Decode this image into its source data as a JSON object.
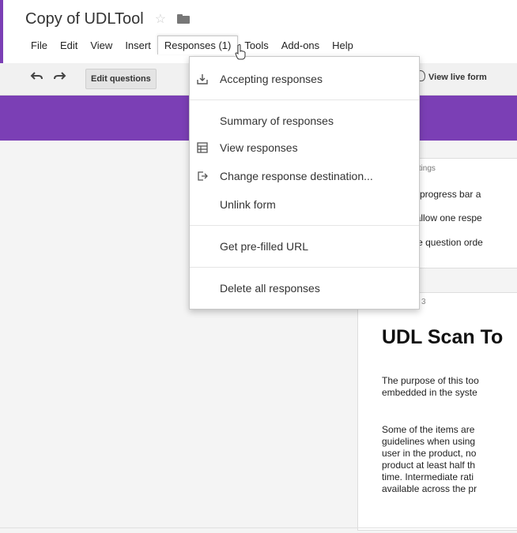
{
  "app": {
    "title": "Copy of UDLTool",
    "accent_color": "#7b3fb5",
    "star_icon": "star-icon",
    "folder_icon": "folder-icon"
  },
  "menu": {
    "file": "File",
    "edit": "Edit",
    "view": "View",
    "insert": "Insert",
    "responses": "Responses (1)",
    "tools": "Tools",
    "addons": "Add-ons",
    "help": "Help"
  },
  "toolbar": {
    "undo_icon": "undo-icon",
    "redo_icon": "redo-icon",
    "edit_questions": "Edit questions",
    "view_live_form": "View live form"
  },
  "dropdown": {
    "accepting": "Accepting responses",
    "summary": "Summary of responses",
    "view_responses": "View responses",
    "change_destination": "Change response destination...",
    "unlink": "Unlink form",
    "prefilled": "Get pre-filled URL",
    "delete_all": "Delete all responses"
  },
  "settings": {
    "header": "ttings",
    "line1": "w progress bar a",
    "line2": "/ allow one respe",
    "line3": "ffle question orde"
  },
  "form": {
    "tab_label": "3",
    "title": "UDL Scan To",
    "p1": [
      "The purpose of this too",
      "embedded in the syste"
    ],
    "p2": [
      "Some of the items are",
      "guidelines when using",
      "user in the product, no",
      "product at least half th",
      "time.  Intermediate rati",
      "available across the pr"
    ]
  }
}
